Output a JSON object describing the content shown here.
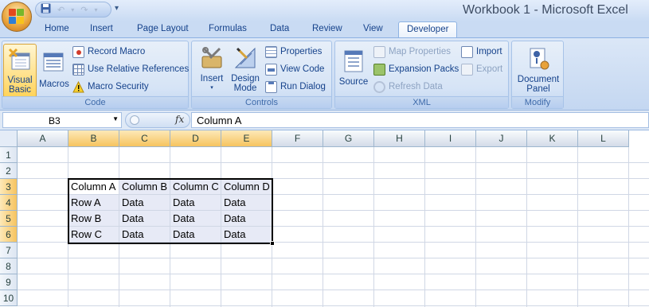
{
  "window": {
    "title": "Workbook 1 - Microsoft Excel"
  },
  "quick_access": {
    "save_icon": "save-icon",
    "undo_icon": "undo-icon",
    "redo_icon": "redo-icon",
    "more": "▾"
  },
  "tabs": [
    "Home",
    "Insert",
    "Page Layout",
    "Formulas",
    "Data",
    "Review",
    "View",
    "Developer"
  ],
  "active_tab": "Developer",
  "ribbon": {
    "code": {
      "label": "Code",
      "visual_basic": "Visual Basic",
      "macros": "Macros",
      "record_macro": "Record Macro",
      "use_relative_references": "Use Relative References",
      "macro_security": "Macro Security"
    },
    "controls": {
      "label": "Controls",
      "insert": "Insert",
      "design_mode": "Design Mode",
      "properties": "Properties",
      "view_code": "View Code",
      "run_dialog": "Run Dialog"
    },
    "xml": {
      "label": "XML",
      "source": "Source",
      "map_properties": "Map Properties",
      "expansion_packs": "Expansion Packs",
      "refresh_data": "Refresh Data",
      "import": "Import",
      "export": "Export"
    },
    "modify": {
      "label": "Modify",
      "document_panel": "Document Panel"
    }
  },
  "formula_bar": {
    "name_box": "B3",
    "fx": "fx",
    "content": "Column A"
  },
  "grid": {
    "columns": [
      "A",
      "B",
      "C",
      "D",
      "E",
      "F",
      "G",
      "H",
      "I",
      "J",
      "K",
      "L"
    ],
    "rows": [
      "1",
      "2",
      "3",
      "4",
      "5",
      "6",
      "7",
      "8",
      "9",
      "10"
    ],
    "selected_columns": [
      "B",
      "C",
      "D",
      "E"
    ],
    "selected_rows": [
      "3",
      "4",
      "5",
      "6"
    ],
    "table": [
      [
        "Column A",
        "Column B",
        "Column C",
        "Column D"
      ],
      [
        "Row A",
        "Data",
        "Data",
        "Data"
      ],
      [
        "Row B",
        "Data",
        "Data",
        "Data"
      ],
      [
        "Row C",
        "Data",
        "Data",
        "Data"
      ]
    ]
  },
  "colors": {
    "accent": "#15428b",
    "selection": "#e7eaf6",
    "header_selected": "#f6c35f"
  }
}
